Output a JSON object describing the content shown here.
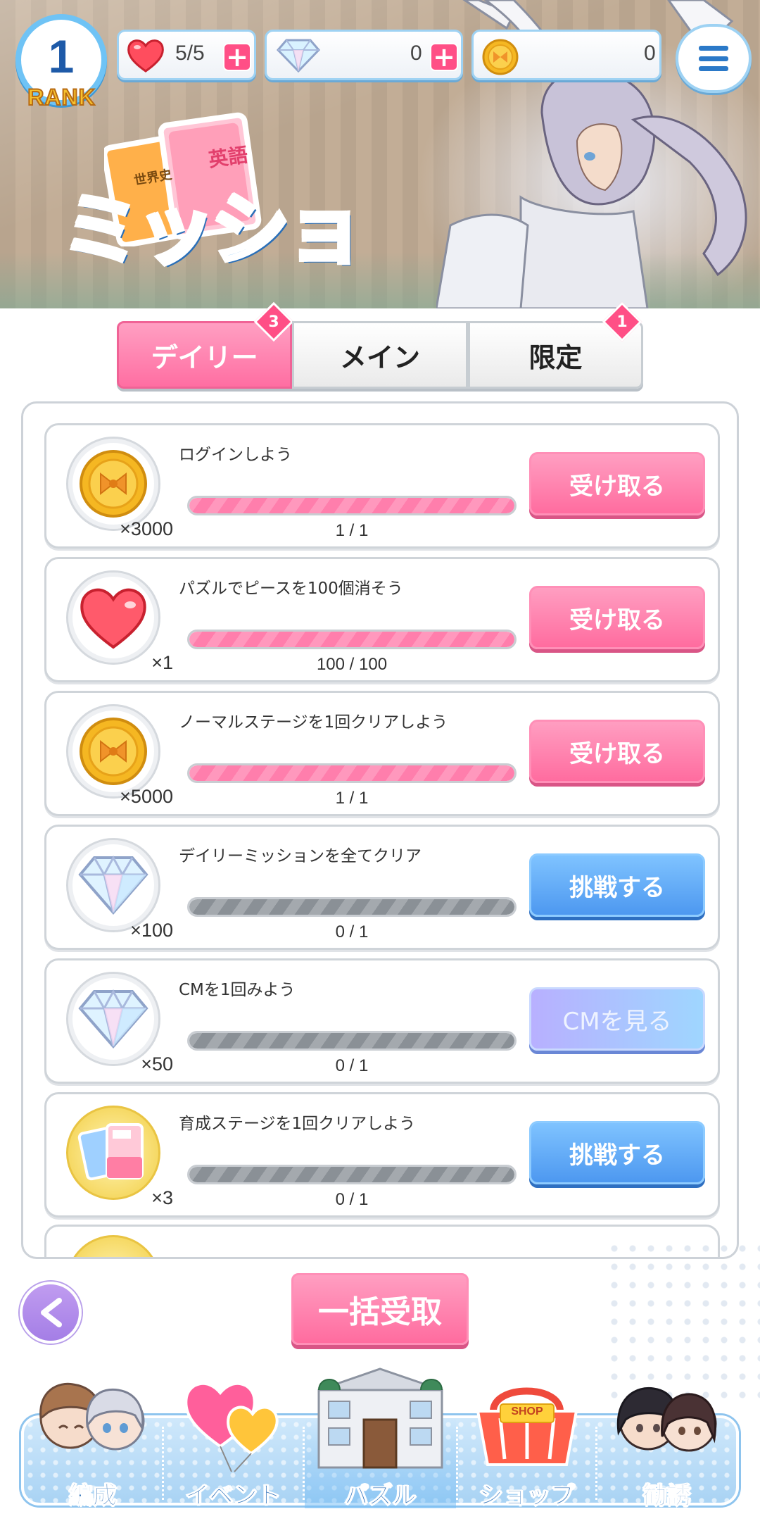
{
  "header": {
    "rank_number": "1",
    "rank_label": "RANK",
    "stamina": "5/5",
    "gems": "0",
    "coins": "0",
    "title": "ミッション",
    "book_label_1": "英語",
    "book_label_2": "世界史"
  },
  "tabs": [
    {
      "label": "デイリー",
      "badge": "3",
      "active": true
    },
    {
      "label": "メイン",
      "badge": "",
      "active": false
    },
    {
      "label": "限定",
      "badge": "1",
      "active": false
    }
  ],
  "missions": [
    {
      "title": "ログインしよう",
      "reward_icon": "coin-icon",
      "reward_qty": "×3000",
      "progress_text": "1 / 1",
      "progress": 1.0,
      "action": "受け取る",
      "action_type": "claim"
    },
    {
      "title": "パズルでピースを100個消そう",
      "reward_icon": "heart-icon",
      "reward_qty": "×1",
      "progress_text": "100 / 100",
      "progress": 1.0,
      "action": "受け取る",
      "action_type": "claim"
    },
    {
      "title": "ノーマルステージを1回クリアしよう",
      "reward_icon": "coin-icon",
      "reward_qty": "×5000",
      "progress_text": "1 / 1",
      "progress": 1.0,
      "action": "受け取る",
      "action_type": "claim"
    },
    {
      "title": "デイリーミッションを全てクリア",
      "reward_icon": "diamond-icon",
      "reward_qty": "×100",
      "progress_text": "0 / 1",
      "progress": 0.0,
      "action": "挑戦する",
      "action_type": "try"
    },
    {
      "title": "CMを1回みよう",
      "reward_icon": "diamond-icon",
      "reward_qty": "×50",
      "progress_text": "0 / 1",
      "progress": 0.0,
      "action": "CMを見る",
      "action_type": "cm"
    },
    {
      "title": "育成ステージを1回クリアしよう",
      "reward_icon": "book-ticket-icon",
      "reward_qty": "×3",
      "progress_text": "0 / 1",
      "progress": 0.0,
      "action": "挑戦する",
      "action_type": "try"
    }
  ],
  "bulk_claim_label": "一括受取",
  "nav": [
    {
      "label": "編成",
      "icon": "characters-icon"
    },
    {
      "label": "イベント",
      "icon": "heart-balloons-icon"
    },
    {
      "label": "パズル",
      "icon": "school-building-icon",
      "active": true
    },
    {
      "label": "ショップ",
      "icon": "shop-basket-icon",
      "sign": "SHOP"
    },
    {
      "label": "勧誘",
      "icon": "recruit-characters-icon"
    }
  ],
  "colors": {
    "pink": "#ff6c9f",
    "blue": "#4d98f0",
    "nav_text": "#2c6fb8"
  }
}
